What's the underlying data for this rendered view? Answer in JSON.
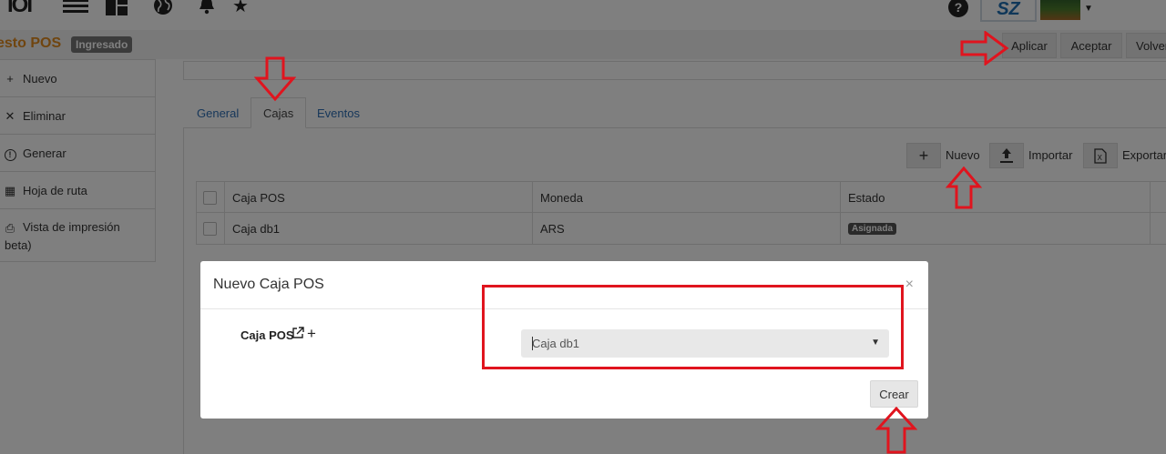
{
  "topbar": {
    "brand_logo": "IOI",
    "icons": [
      "menu-icon",
      "dashboard-icon",
      "globe-icon",
      "bell-icon",
      "star-icon",
      "help-icon"
    ],
    "help_glyph": "?",
    "company_logo": "SZ"
  },
  "header": {
    "title": "esto POS",
    "status": "Ingresado",
    "buttons": {
      "aplicar": "Aplicar",
      "aceptar": "Aceptar",
      "volver": "Volver"
    }
  },
  "sidebar": {
    "items": [
      {
        "icon": "plus-icon",
        "glyph": "+",
        "label": "Nuevo"
      },
      {
        "icon": "close-icon",
        "glyph": "✕",
        "label": "Eliminar"
      },
      {
        "icon": "alert-icon",
        "glyph": "!",
        "label": "Generar"
      },
      {
        "icon": "calendar-icon",
        "glyph": "▦",
        "label": "Hoja de ruta"
      },
      {
        "icon": "print-icon",
        "glyph": "⎙",
        "label": "Vista de impresión",
        "label2": "beta)"
      }
    ]
  },
  "tabs": {
    "general": "General",
    "cajas": "Cajas",
    "eventos": "Eventos"
  },
  "toolbar": {
    "nuevo": "Nuevo",
    "importar": "Importar",
    "exportar": "Exportar"
  },
  "table": {
    "headers": {
      "caja": "Caja POS",
      "moneda": "Moneda",
      "estado": "Estado"
    },
    "rows": [
      {
        "caja": "Caja db1",
        "moneda": "ARS",
        "estado": "Asignada"
      }
    ]
  },
  "modal": {
    "title": "Nuevo Caja POS",
    "close": "×",
    "field_label": "Caja POS",
    "select_value": "Caja db1",
    "submit": "Crear"
  },
  "colors": {
    "annotation": "#e0141e",
    "title_orange": "#e08a1e",
    "link_blue": "#2f6fb5"
  }
}
